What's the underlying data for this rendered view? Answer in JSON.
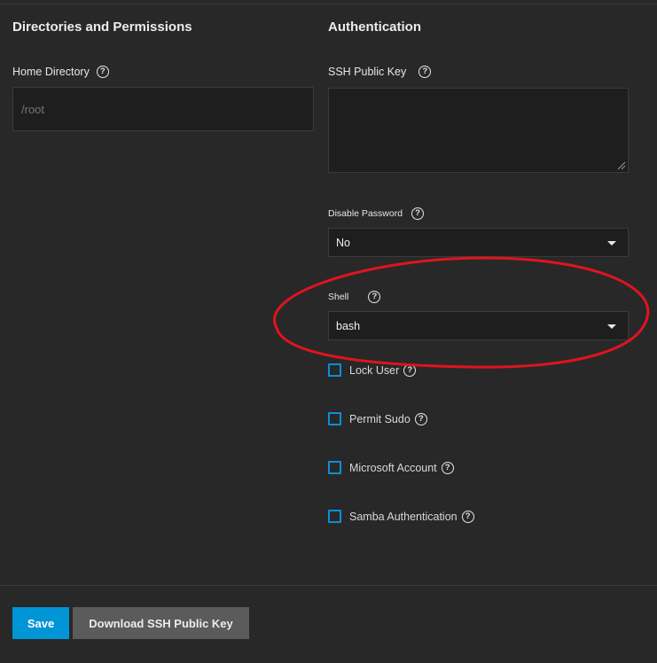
{
  "directories": {
    "section_title": "Directories and Permissions",
    "home_directory": {
      "label": "Home Directory",
      "placeholder": "/root"
    }
  },
  "authentication": {
    "section_title": "Authentication",
    "ssh_public_key": {
      "label": "SSH Public Key",
      "value": ""
    },
    "disable_password": {
      "label": "Disable Password",
      "selected": "No"
    },
    "shell": {
      "label": "Shell",
      "selected": "bash"
    },
    "checkboxes": [
      {
        "label": "Lock User",
        "checked": false
      },
      {
        "label": "Permit Sudo",
        "checked": false
      },
      {
        "label": "Microsoft Account",
        "checked": false
      },
      {
        "label": "Samba Authentication",
        "checked": false
      }
    ]
  },
  "actions": {
    "save_label": "Save",
    "download_label": "Download SSH Public Key"
  },
  "icons": {
    "help": "help-circle-icon",
    "dropdown": "chevron-down-icon"
  },
  "colors": {
    "accent": "#0095d5",
    "checkbox_border": "#0b8fd8",
    "annotation": "#e0141e"
  }
}
